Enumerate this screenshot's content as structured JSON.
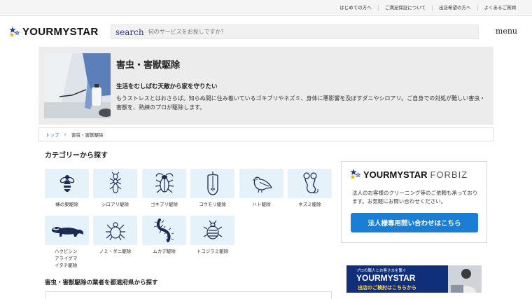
{
  "topbar": {
    "links": [
      "はじめての方へ",
      "ご満足保証について",
      "出店希望の方へ",
      "よくあるご質問"
    ]
  },
  "header": {
    "logo_text": "YOURMYSTAR",
    "search_label": "search",
    "search_placeholder": "何のサービスをお探しですか？",
    "menu_label": "menu"
  },
  "hero": {
    "title": "害虫・害獣駆除",
    "subtitle": "生活をむしばむ天敵から家を守りたい",
    "description": "もうストレスとはおさらば。知らぬ間に住み着いているゴキブリやネズミ、身体に悪影響を及ぼすダニやシロアリ。ご自身での対処が難しい害虫・害獣を、熟練のプロが駆除します。"
  },
  "breadcrumb": {
    "home": "トップ",
    "separator": ">",
    "current": "害虫・害獣駆除"
  },
  "categories": {
    "title": "カテゴリーから探す",
    "items": [
      {
        "label": "蜂の巣駆除",
        "icon": "bee-icon"
      },
      {
        "label": "シロアリ駆除",
        "icon": "termite-icon"
      },
      {
        "label": "ゴキブリ駆除",
        "icon": "cockroach-icon"
      },
      {
        "label": "コウモリ駆除",
        "icon": "bat-icon"
      },
      {
        "label": "ハト駆除",
        "icon": "pigeon-icon"
      },
      {
        "label": "ネズミ駆除",
        "icon": "mouse-icon"
      },
      {
        "label": "ハクビシンアライグマイタチ駆除",
        "icon": "civet-icon"
      },
      {
        "label": "ノミ・ダニ駆除",
        "icon": "mite-icon"
      },
      {
        "label": "ムカデ駆除",
        "icon": "centipede-icon"
      },
      {
        "label": "トコジラミ駆除",
        "icon": "bedbug-icon"
      }
    ]
  },
  "prefecture": {
    "title": "害虫・害獣駆除の業者を都道府県から探す"
  },
  "forbiz": {
    "logo_main": "YOURMYSTAR",
    "logo_sub": "FORBIZ",
    "description": "法人のお客様のクリーニング等のご依頼も承っております。お気軽にお問い合わせください。",
    "button_label": "法人様専用問い合わせはこちら"
  },
  "banner": {
    "tagline": "プロの職人とお客さまを繋ぐ",
    "brand": "YOURMYSTAR",
    "cta": "出店のご検討はこちらから"
  },
  "colors": {
    "accent_blue": "#1a7fd4",
    "navy": "#0f2f7a",
    "tile_bg": "#e6f2fa",
    "star_gold": "#e8b400"
  }
}
